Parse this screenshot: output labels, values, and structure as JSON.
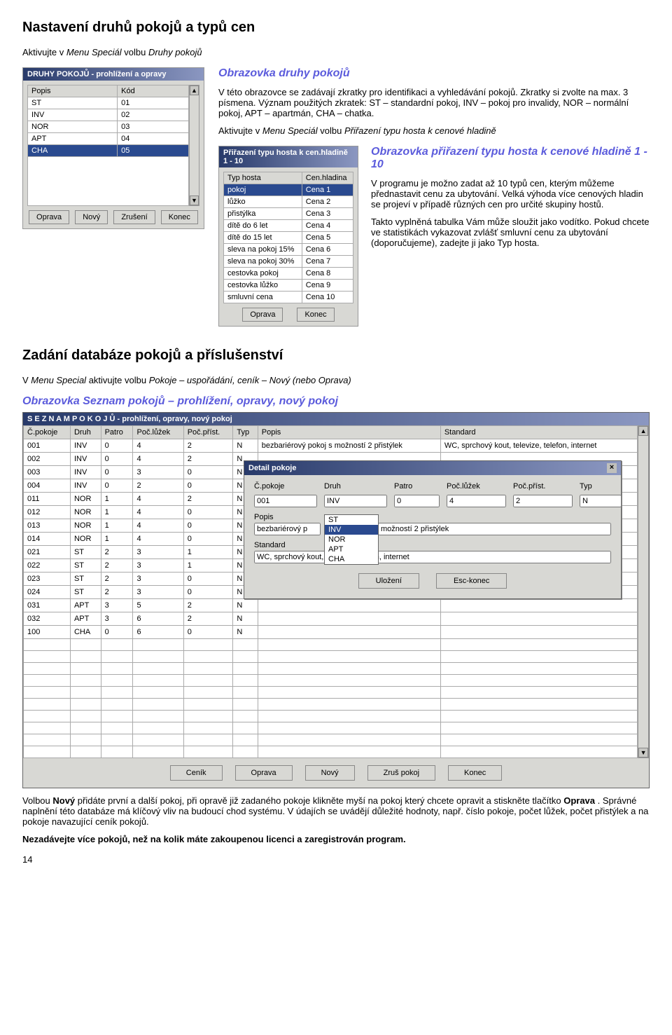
{
  "section1": {
    "title": "Nastavení druhů pokojů a typů cen",
    "instruction_prefix": "Aktivujte v ",
    "instruction_menu": "Menu Speciál",
    "instruction_mid": " volbu ",
    "instruction_item": "Druhy pokojů",
    "win1": {
      "title": "DRUHY POKOJŮ - prohlížení a opravy",
      "col_popis": "Popis",
      "col_kod": "Kód",
      "rows": [
        {
          "popis": "ST",
          "kod": "01"
        },
        {
          "popis": "INV",
          "kod": "02"
        },
        {
          "popis": "NOR",
          "kod": "03"
        },
        {
          "popis": "APT",
          "kod": "04"
        },
        {
          "popis": "CHA",
          "kod": "05"
        }
      ],
      "btns": {
        "oprava": "Oprava",
        "novy": "Nový",
        "zruseni": "Zrušení",
        "konec": "Konec"
      }
    },
    "right_heading": "Obrazovka druhy pokojů",
    "p1": "V této obrazovce se zadávají zkratky pro identifikaci a vyhledávání pokojů. Zkratky si zvolte na max. 3 písmena. Význam použitých zkratek: ST – standardní pokoj, INV – pokoj pro invalidy, NOR – normální pokoj, APT – apartmán, CHA – chatka.",
    "nested_instruction_prefix": "Aktivujte v ",
    "nested_instruction_menu": "Menu Speciál",
    "nested_instruction_mid": " volbu ",
    "nested_instruction_item": "Přiřazení typu hosta k cenové hladině",
    "win2": {
      "title": "Přiřazení typu hosta k cen.hladině  1 - 10",
      "col_typ": "Typ hosta",
      "col_cena": "Cen.hladina",
      "rows": [
        {
          "typ": "pokoj",
          "cena": "Cena 1"
        },
        {
          "typ": "lůžko",
          "cena": "Cena 2"
        },
        {
          "typ": "přistýlka",
          "cena": "Cena 3"
        },
        {
          "typ": "dítě do 6 let",
          "cena": "Cena 4"
        },
        {
          "typ": "dítě do 15 let",
          "cena": "Cena 5"
        },
        {
          "typ": "sleva na pokoj 15%",
          "cena": "Cena 6"
        },
        {
          "typ": "sleva na pokoj 30%",
          "cena": "Cena 7"
        },
        {
          "typ": "cestovka pokoj",
          "cena": "Cena 8"
        },
        {
          "typ": "cestovka lůžko",
          "cena": "Cena 9"
        },
        {
          "typ": "smluvní cena",
          "cena": "Cena 10"
        }
      ],
      "btns": {
        "oprava": "Oprava",
        "konec": "Konec"
      }
    },
    "nested_heading": "Obrazovka přiřazení typu hosta k cenové hladině 1 - 10",
    "p2": "V programu je možno zadat až 10 typů cen, kterým můžeme přednastavit cenu za ubytování. Velká výhoda více cenových hladin se projeví v případě různých cen pro určité skupiny hostů.",
    "p3": "Takto vyplněná tabulka Vám může sloužit jako vodítko. Pokud chcete ve statistikách vykazovat zvlášť smluvní cenu za ubytování (doporučujeme), zadejte ji jako Typ hosta."
  },
  "section2": {
    "title": "Zadání databáze pokojů a příslušenství",
    "instr_prefix": "V ",
    "instr_menu": "Menu Special",
    "instr_mid": " aktivujte volbu ",
    "instr_item": "Pokoje – uspořádání, ceník – Nový (nebo Oprava)",
    "heading": "Obrazovka Seznam pokojů – prohlížení, opravy, nový pokoj",
    "win3": {
      "title": "S E Z N A M   P O K O J Ů  - prohlížení, opravy, nový pokoj",
      "cols": {
        "c": "Č.pokoje",
        "druh": "Druh",
        "patro": "Patro",
        "luzek": "Poč.lůžek",
        "prist": "Poč.příst.",
        "typ": "Typ",
        "popis": "Popis",
        "standard": "Standard"
      },
      "rows": [
        {
          "c": "001",
          "druh": "INV",
          "patro": "0",
          "luzek": "4",
          "prist": "2",
          "typ": "N",
          "popis": "bezbariérový pokoj s možností 2 přistýlek",
          "standard": "WC, sprchový kout, televize, telefon, internet"
        },
        {
          "c": "002",
          "druh": "INV",
          "patro": "0",
          "luzek": "4",
          "prist": "2",
          "typ": "N",
          "popis": "",
          "standard": ""
        },
        {
          "c": "003",
          "druh": "INV",
          "patro": "0",
          "luzek": "3",
          "prist": "0",
          "typ": "N",
          "popis": "",
          "standard": ""
        },
        {
          "c": "004",
          "druh": "INV",
          "patro": "0",
          "luzek": "2",
          "prist": "0",
          "typ": "N",
          "popis": "",
          "standard": ""
        },
        {
          "c": "011",
          "druh": "NOR",
          "patro": "1",
          "luzek": "4",
          "prist": "2",
          "typ": "N",
          "popis": "",
          "standard": ""
        },
        {
          "c": "012",
          "druh": "NOR",
          "patro": "1",
          "luzek": "4",
          "prist": "0",
          "typ": "N",
          "popis": "",
          "standard": ""
        },
        {
          "c": "013",
          "druh": "NOR",
          "patro": "1",
          "luzek": "4",
          "prist": "0",
          "typ": "N",
          "popis": "",
          "standard": ""
        },
        {
          "c": "014",
          "druh": "NOR",
          "patro": "1",
          "luzek": "4",
          "prist": "0",
          "typ": "N",
          "popis": "",
          "standard": ""
        },
        {
          "c": "021",
          "druh": "ST",
          "patro": "2",
          "luzek": "3",
          "prist": "1",
          "typ": "N",
          "popis": "",
          "standard": ""
        },
        {
          "c": "022",
          "druh": "ST",
          "patro": "2",
          "luzek": "3",
          "prist": "1",
          "typ": "N",
          "popis": "",
          "standard": ""
        },
        {
          "c": "023",
          "druh": "ST",
          "patro": "2",
          "luzek": "3",
          "prist": "0",
          "typ": "N",
          "popis": "",
          "standard": ""
        },
        {
          "c": "024",
          "druh": "ST",
          "patro": "2",
          "luzek": "3",
          "prist": "0",
          "typ": "N",
          "popis": "",
          "standard": ""
        },
        {
          "c": "031",
          "druh": "APT",
          "patro": "3",
          "luzek": "5",
          "prist": "2",
          "typ": "N",
          "popis": "",
          "standard": ""
        },
        {
          "c": "032",
          "druh": "APT",
          "patro": "3",
          "luzek": "6",
          "prist": "2",
          "typ": "N",
          "popis": "",
          "standard": ""
        },
        {
          "c": "100",
          "druh": "CHA",
          "patro": "0",
          "luzek": "6",
          "prist": "0",
          "typ": "N",
          "popis": "",
          "standard": ""
        }
      ],
      "btns": {
        "cenik": "Ceník",
        "oprava": "Oprava",
        "novy": "Nový",
        "zrus": "Zruš pokoj",
        "konec": "Konec"
      }
    },
    "detail": {
      "title": "Detail pokoje",
      "labels": {
        "c": "Č.pokoje",
        "druh": "Druh",
        "patro": "Patro",
        "luzek": "Poč.lůžek",
        "prist": "Poč.příst.",
        "typ": "Typ",
        "popis": "Popis",
        "standard": "Standard"
      },
      "values": {
        "c": "001",
        "druh": "INV",
        "patro": "0",
        "luzek": "4",
        "prist": "2",
        "typ": "N",
        "popis": "bezbariérový p",
        "popis_suffix": "možností 2 přistýlek",
        "standard": "WC, sprchový kout, televize, telefon, internet"
      },
      "dropdown": [
        "ST",
        "INV",
        "NOR",
        "APT",
        "CHA"
      ],
      "dropdown_selected": "INV",
      "btns": {
        "ulozeni": "Uložení",
        "esc": "Esc-konec"
      }
    },
    "footer_p1_a": "Volbou ",
    "footer_p1_bold": "Nový",
    "footer_p1_b": " přidáte první a další pokoj, při opravě již zadaného pokoje klikněte myší na pokoj který chcete opravit a stiskněte tlačítko ",
    "footer_p1_bold2": "Oprava",
    "footer_p1_c": ". Správné naplnění této databáze má klíčový vliv na budoucí chod systému. V údajích se uvádějí důležité hodnoty, např. číslo pokoje, počet lůžek, počet přistýlek a na pokoje navazující ceník pokojů.",
    "footer_p2": "Nezadávejte více pokojů, než na kolik máte zakoupenou licenci a zaregistrován program.",
    "page_no": "14"
  }
}
